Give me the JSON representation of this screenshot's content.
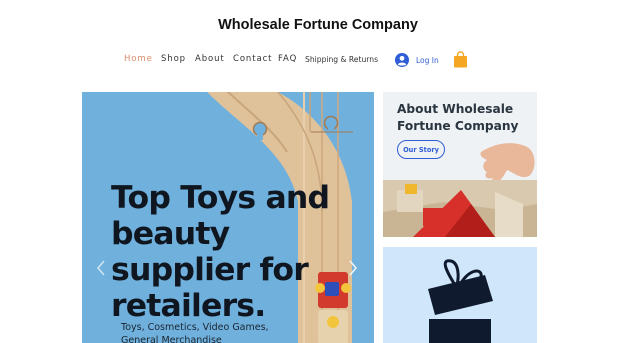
{
  "header": {
    "title": "Wholesale Fortune Company"
  },
  "nav": {
    "items": [
      {
        "label": "Home",
        "active": true
      },
      {
        "label": "Shop"
      },
      {
        "label": "About"
      },
      {
        "label": "Contact"
      },
      {
        "label": "FAQ"
      },
      {
        "label": "Shipping & Returns"
      }
    ],
    "login_label": "Log In"
  },
  "hero": {
    "heading": "Top Toys and beauty supplier for retailers.",
    "subtext": "Toys, Cosmetics, Video Games, General Merchandise"
  },
  "about": {
    "title": "About Wholesale Fortune Company",
    "button_label": "Our Story"
  },
  "colors": {
    "accent": "#2f5dd6",
    "nav_active": "#d98e6a",
    "hero_bg": "#6fb0dc",
    "cart": "#f5a623",
    "gift_bg": "#cfe6fb",
    "gift_box": "#101a2e"
  },
  "icons": [
    "avatar-icon",
    "cart-icon",
    "chevron-left-icon",
    "chevron-right-icon"
  ]
}
